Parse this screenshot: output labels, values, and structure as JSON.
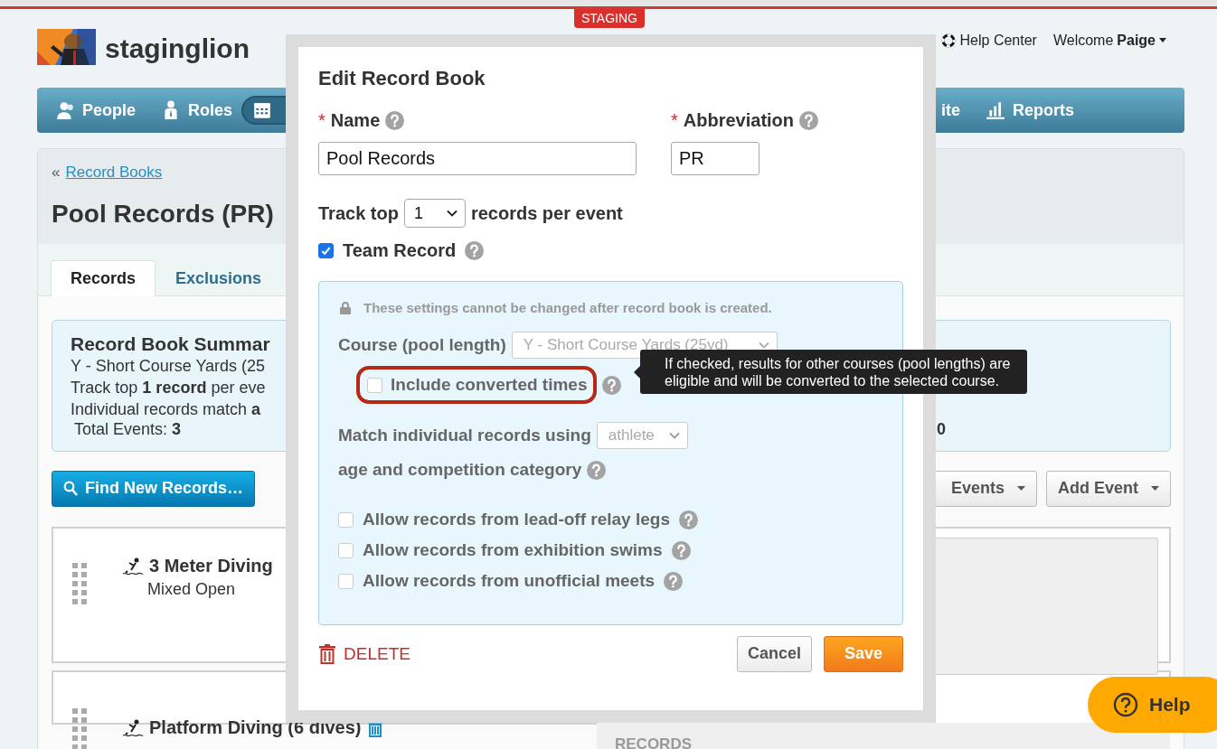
{
  "staging_badge": "STAGING",
  "header": {
    "site_name": "staginglion",
    "help_link": "Help Center",
    "welcome": "Welcome **Paige**"
  },
  "nav": {
    "items": [
      {
        "label": "People",
        "selected": false
      },
      {
        "label": "Roles",
        "selected": false
      },
      {
        "selected": true
      },
      {
        "label": "ite",
        "selected": false
      },
      {
        "label": "Reports",
        "selected": false
      }
    ]
  },
  "breadcrumb": {
    "prefix": "«",
    "link": "Record Books"
  },
  "page_title": "Pool Records (PR)",
  "tabs": [
    {
      "label": "Records",
      "selected": true
    },
    {
      "label": "Exclusions",
      "selected": false
    }
  ],
  "summary": {
    "title": "Record Book Summar",
    "lines": [
      "Y - Short Course Yards (25",
      "Track top **1 record** per eve",
      "Individual records match **a**"
    ],
    "total": "Total Events: **3**",
    "right_value": "0"
  },
  "actions": {
    "find_button": "Find New Records…",
    "events_button": "Events",
    "add_event_button": "Add Event"
  },
  "events": [
    {
      "name": "3 Meter Diving",
      "category": "Mixed Open"
    },
    {
      "name": "Platform Diving (6 dives)"
    }
  ],
  "records_label": "RECORDS",
  "modal": {
    "title": "Edit Record Book",
    "name_field": {
      "required_mark": "*",
      "label": "Name",
      "value": "Pool Records"
    },
    "abbr_field": {
      "required_mark": "*",
      "label": "Abbreviation",
      "value": "PR"
    },
    "track": {
      "prefix": "Track top",
      "value": "1",
      "suffix": "records per event"
    },
    "team_record": {
      "label": "Team Record",
      "checked": true
    },
    "locked_note": "These settings cannot be changed after record book is created.",
    "course": {
      "label": "Course (pool length)",
      "value": "Y - Short Course Yards (25yd)"
    },
    "include_converted": {
      "label": "Include converted times",
      "checked": false
    },
    "match": {
      "label": "Match individual records using",
      "value": "athlete",
      "label_2": "age and competition category"
    },
    "options": [
      {
        "label": "Allow records from lead-off relay legs",
        "checked": false
      },
      {
        "label": "Allow records from exhibition swims",
        "checked": false
      },
      {
        "label": "Allow records from unofficial meets",
        "checked": false
      }
    ],
    "delete": "DELETE",
    "cancel": "Cancel",
    "save": "Save"
  },
  "tooltip": "If checked, results for other courses (pool lengths) are eligible and will be converted to the selected course.",
  "help_button": "Help"
}
